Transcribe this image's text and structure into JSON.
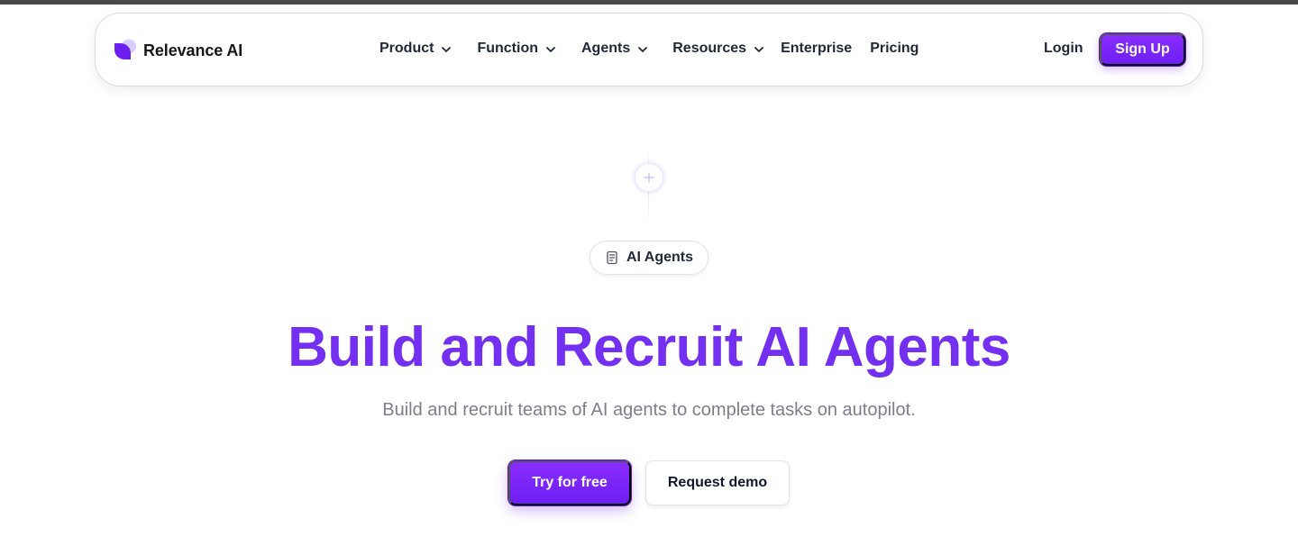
{
  "colors": {
    "accent": "#7330f0",
    "button_gradient_top": "#8a2cff",
    "button_gradient_bottom": "#6d1ff2",
    "subtitle": "#7b7f8c"
  },
  "brand": {
    "name": "Relevance AI",
    "logo_icon": "relevance-logo-icon"
  },
  "nav": {
    "items": [
      {
        "label": "Product",
        "has_dropdown": true
      },
      {
        "label": "Function",
        "has_dropdown": true
      },
      {
        "label": "Agents",
        "has_dropdown": true
      },
      {
        "label": "Resources",
        "has_dropdown": true
      },
      {
        "label": "Enterprise",
        "has_dropdown": false
      },
      {
        "label": "Pricing",
        "has_dropdown": false
      }
    ],
    "login_label": "Login",
    "signup_label": "Sign Up"
  },
  "hero": {
    "plus_icon": "plus-icon",
    "badge_icon": "document-icon",
    "badge_label": "AI Agents",
    "title": "Build and Recruit AI Agents",
    "subtitle": "Build and recruit teams of AI agents to complete tasks on autopilot.",
    "primary_cta": "Try for free",
    "secondary_cta": "Request demo"
  }
}
